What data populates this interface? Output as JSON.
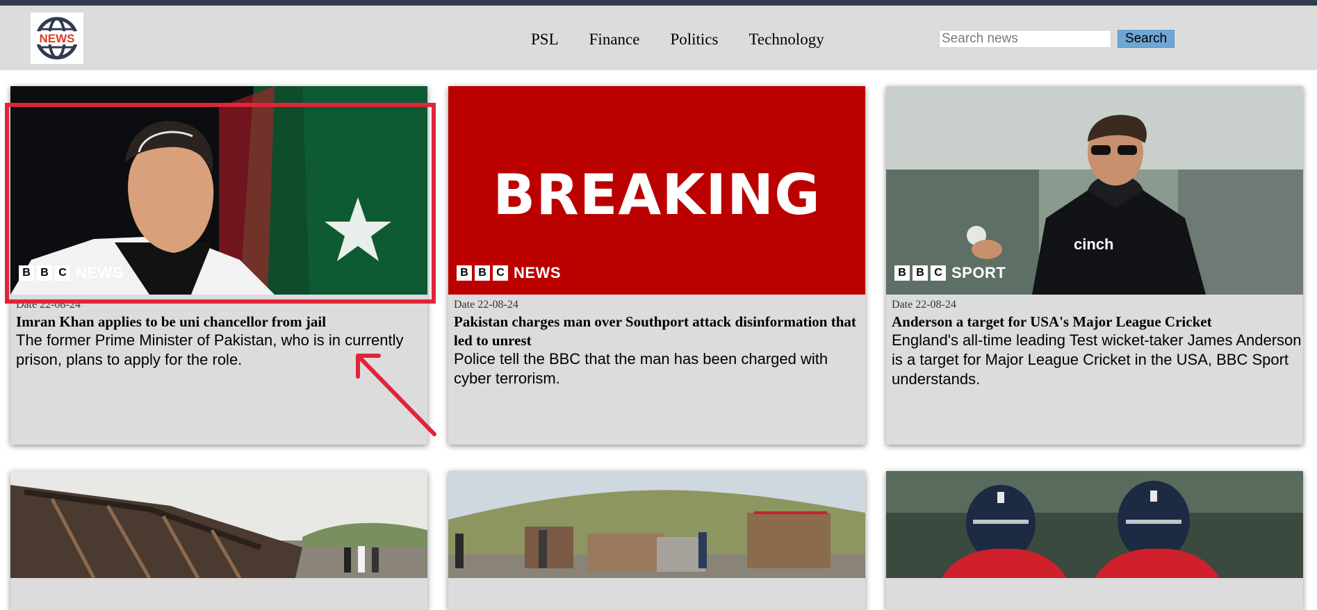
{
  "header": {
    "logo_text": "NEWS",
    "nav": [
      {
        "label": "PSL"
      },
      {
        "label": "Finance"
      },
      {
        "label": "Politics"
      },
      {
        "label": "Technology"
      }
    ],
    "search": {
      "placeholder": "Search news",
      "button_label": "Search"
    }
  },
  "cards": [
    {
      "image": "imran-khan-photo",
      "brand": {
        "letters": [
          "B",
          "B",
          "C"
        ],
        "word": "NEWS"
      },
      "date": "Date 22-08-24",
      "title": "Imran Khan applies to be uni chancellor from jail",
      "summary": "The former Prime Minister of Pakistan, who is in currently prison, plans to apply for the role."
    },
    {
      "image": "breaking-banner",
      "image_text": "BREAKING",
      "brand": {
        "letters": [
          "B",
          "B",
          "C"
        ],
        "word": "NEWS"
      },
      "date": "Date 22-08-24",
      "title": "Pakistan charges man over Southport attack disinformation that led to unrest",
      "summary": "Police tell the BBC that the man has been charged with cyber terrorism."
    },
    {
      "image": "james-anderson-photo",
      "brand": {
        "letters": [
          "B",
          "B",
          "C"
        ],
        "word": "SPORT"
      },
      "date": "Date 22-08-24",
      "title": "Anderson a target for USA's Major League Cricket",
      "summary": "England's all-time leading Test wicket-taker James Anderson is a target for Major League Cricket in the USA, BBC Sport understands."
    },
    {
      "image": "burnt-bus-photo"
    },
    {
      "image": "burnt-vehicles-roadside-photo"
    },
    {
      "image": "england-cricketers-photo"
    }
  ],
  "colors": {
    "topbar": "#2e3d4c",
    "navbar": "#dcdcdc",
    "card": "#dcdcdc",
    "breaking_red": "#bb0000",
    "search_button": "#6fa6d6",
    "annotation_red": "#e0243a"
  }
}
